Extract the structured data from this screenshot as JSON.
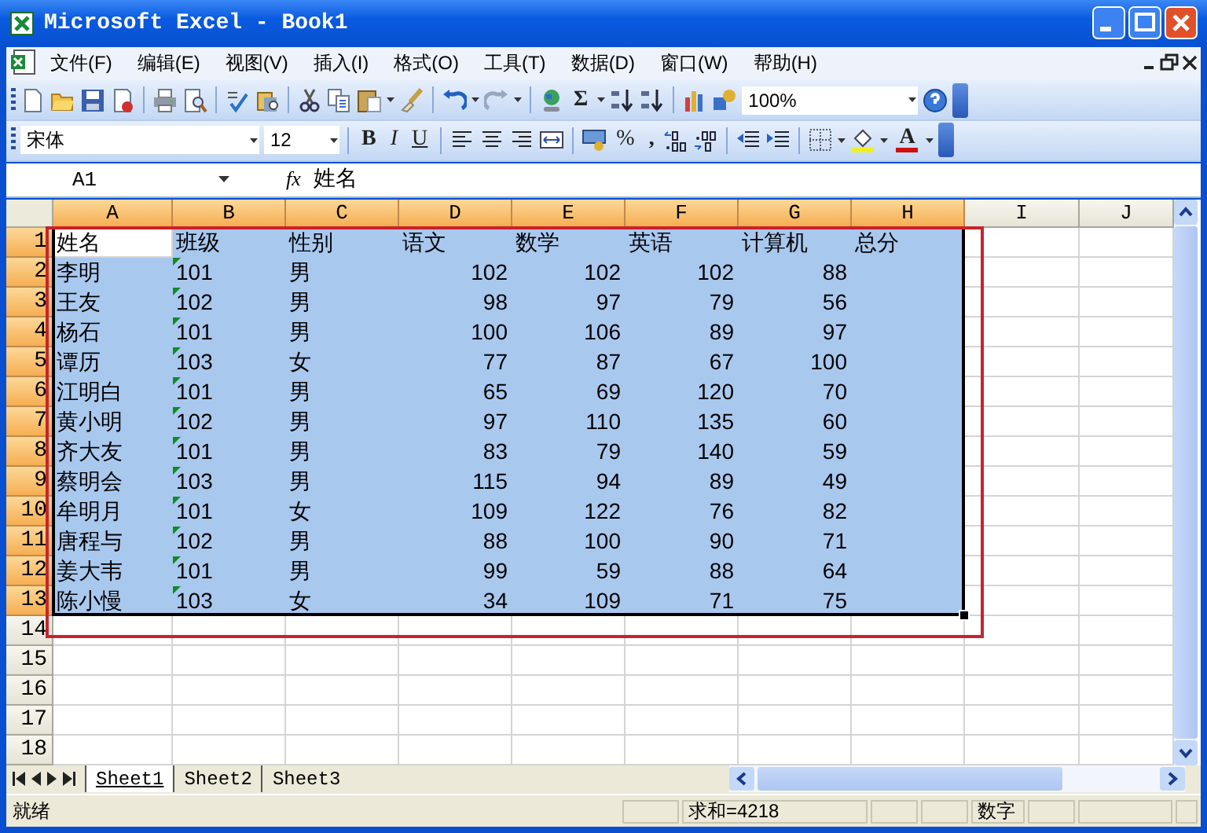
{
  "window": {
    "title": "Microsoft Excel - Book1"
  },
  "menu": [
    {
      "label": "文件(F)"
    },
    {
      "label": "编辑(E)"
    },
    {
      "label": "视图(V)"
    },
    {
      "label": "插入(I)"
    },
    {
      "label": "格式(O)"
    },
    {
      "label": "工具(T)"
    },
    {
      "label": "数据(D)"
    },
    {
      "label": "窗口(W)"
    },
    {
      "label": "帮助(H)"
    }
  ],
  "standard_toolbar": {
    "autosum": "Σ",
    "zoom": "100%"
  },
  "format_toolbar": {
    "font": "宋体",
    "size": "12",
    "bold": "B",
    "italic": "I",
    "underline": "U",
    "percent": "%",
    "comma": ",",
    "font_color": "A"
  },
  "formula_bar": {
    "name_box": "A1",
    "function_label": "fx",
    "formula": "姓名"
  },
  "columns": [
    {
      "label": "A",
      "selected": true
    },
    {
      "label": "B",
      "selected": true
    },
    {
      "label": "C",
      "selected": true
    },
    {
      "label": "D",
      "selected": true
    },
    {
      "label": "E",
      "selected": true
    },
    {
      "label": "F",
      "selected": true
    },
    {
      "label": "G",
      "selected": true
    },
    {
      "label": "H",
      "selected": true
    },
    {
      "label": "I",
      "selected": false
    },
    {
      "label": "J",
      "selected": false
    }
  ],
  "rows": [
    {
      "number": "1",
      "selected": true,
      "cells": [
        {
          "text": "姓名",
          "kind": "text",
          "active": true
        },
        {
          "text": "班级",
          "kind": "text",
          "active": false
        },
        {
          "text": "性别",
          "kind": "text",
          "active": false
        },
        {
          "text": "语文",
          "kind": "text",
          "active": false
        },
        {
          "text": "数学",
          "kind": "text",
          "active": false
        },
        {
          "text": "英语",
          "kind": "text",
          "active": false
        },
        {
          "text": "计算机",
          "kind": "text",
          "active": false
        },
        {
          "text": "总分",
          "kind": "text",
          "active": false
        }
      ]
    },
    {
      "number": "2",
      "selected": true,
      "cells": [
        {
          "text": "李明",
          "kind": "text",
          "active": false
        },
        {
          "text": "101",
          "kind": "flagged",
          "active": false
        },
        {
          "text": "男",
          "kind": "text",
          "active": false
        },
        {
          "text": "102",
          "kind": "number",
          "active": false
        },
        {
          "text": "102",
          "kind": "number",
          "active": false
        },
        {
          "text": "102",
          "kind": "number",
          "active": false
        },
        {
          "text": "88",
          "kind": "number",
          "active": false
        }
      ]
    },
    {
      "number": "3",
      "selected": true,
      "cells": [
        {
          "text": "王友",
          "kind": "text",
          "active": false
        },
        {
          "text": "102",
          "kind": "flagged",
          "active": false
        },
        {
          "text": "男",
          "kind": "text",
          "active": false
        },
        {
          "text": "98",
          "kind": "number",
          "active": false
        },
        {
          "text": "97",
          "kind": "number",
          "active": false
        },
        {
          "text": "79",
          "kind": "number",
          "active": false
        },
        {
          "text": "56",
          "kind": "number",
          "active": false
        }
      ]
    },
    {
      "number": "4",
      "selected": true,
      "cells": [
        {
          "text": "杨石",
          "kind": "text",
          "active": false
        },
        {
          "text": "101",
          "kind": "flagged",
          "active": false
        },
        {
          "text": "男",
          "kind": "text",
          "active": false
        },
        {
          "text": "100",
          "kind": "number",
          "active": false
        },
        {
          "text": "106",
          "kind": "number",
          "active": false
        },
        {
          "text": "89",
          "kind": "number",
          "active": false
        },
        {
          "text": "97",
          "kind": "number",
          "active": false
        }
      ]
    },
    {
      "number": "5",
      "selected": true,
      "cells": [
        {
          "text": "谭历",
          "kind": "text",
          "active": false
        },
        {
          "text": "103",
          "kind": "flagged",
          "active": false
        },
        {
          "text": "女",
          "kind": "text",
          "active": false
        },
        {
          "text": "77",
          "kind": "number",
          "active": false
        },
        {
          "text": "87",
          "kind": "number",
          "active": false
        },
        {
          "text": "67",
          "kind": "number",
          "active": false
        },
        {
          "text": "100",
          "kind": "number",
          "active": false
        }
      ]
    },
    {
      "number": "6",
      "selected": true,
      "cells": [
        {
          "text": "江明白",
          "kind": "text",
          "active": false
        },
        {
          "text": "101",
          "kind": "flagged",
          "active": false
        },
        {
          "text": "男",
          "kind": "text",
          "active": false
        },
        {
          "text": "65",
          "kind": "number",
          "active": false
        },
        {
          "text": "69",
          "kind": "number",
          "active": false
        },
        {
          "text": "120",
          "kind": "number",
          "active": false
        },
        {
          "text": "70",
          "kind": "number",
          "active": false
        }
      ]
    },
    {
      "number": "7",
      "selected": true,
      "cells": [
        {
          "text": "黄小明",
          "kind": "text",
          "active": false
        },
        {
          "text": "102",
          "kind": "flagged",
          "active": false
        },
        {
          "text": "男",
          "kind": "text",
          "active": false
        },
        {
          "text": "97",
          "kind": "number",
          "active": false
        },
        {
          "text": "110",
          "kind": "number",
          "active": false
        },
        {
          "text": "135",
          "kind": "number",
          "active": false
        },
        {
          "text": "60",
          "kind": "number",
          "active": false
        }
      ]
    },
    {
      "number": "8",
      "selected": true,
      "cells": [
        {
          "text": "齐大友",
          "kind": "text",
          "active": false
        },
        {
          "text": "101",
          "kind": "flagged",
          "active": false
        },
        {
          "text": "男",
          "kind": "text",
          "active": false
        },
        {
          "text": "83",
          "kind": "number",
          "active": false
        },
        {
          "text": "79",
          "kind": "number",
          "active": false
        },
        {
          "text": "140",
          "kind": "number",
          "active": false
        },
        {
          "text": "59",
          "kind": "number",
          "active": false
        }
      ]
    },
    {
      "number": "9",
      "selected": true,
      "cells": [
        {
          "text": "蔡明会",
          "kind": "text",
          "active": false
        },
        {
          "text": "103",
          "kind": "flagged",
          "active": false
        },
        {
          "text": "男",
          "kind": "text",
          "active": false
        },
        {
          "text": "115",
          "kind": "number",
          "active": false
        },
        {
          "text": "94",
          "kind": "number",
          "active": false
        },
        {
          "text": "89",
          "kind": "number",
          "active": false
        },
        {
          "text": "49",
          "kind": "number",
          "active": false
        }
      ]
    },
    {
      "number": "10",
      "selected": true,
      "cells": [
        {
          "text": "牟明月",
          "kind": "text",
          "active": false
        },
        {
          "text": "101",
          "kind": "flagged",
          "active": false
        },
        {
          "text": "女",
          "kind": "text",
          "active": false
        },
        {
          "text": "109",
          "kind": "number",
          "active": false
        },
        {
          "text": "122",
          "kind": "number",
          "active": false
        },
        {
          "text": "76",
          "kind": "number",
          "active": false
        },
        {
          "text": "82",
          "kind": "number",
          "active": false
        }
      ]
    },
    {
      "number": "11",
      "selected": true,
      "cells": [
        {
          "text": "唐程与",
          "kind": "text",
          "active": false
        },
        {
          "text": "102",
          "kind": "flagged",
          "active": false
        },
        {
          "text": "男",
          "kind": "text",
          "active": false
        },
        {
          "text": "88",
          "kind": "number",
          "active": false
        },
        {
          "text": "100",
          "kind": "number",
          "active": false
        },
        {
          "text": "90",
          "kind": "number",
          "active": false
        },
        {
          "text": "71",
          "kind": "number",
          "active": false
        }
      ]
    },
    {
      "number": "12",
      "selected": true,
      "cells": [
        {
          "text": "姜大韦",
          "kind": "text",
          "active": false
        },
        {
          "text": "101",
          "kind": "flagged",
          "active": false
        },
        {
          "text": "男",
          "kind": "text",
          "active": false
        },
        {
          "text": "99",
          "kind": "number",
          "active": false
        },
        {
          "text": "59",
          "kind": "number",
          "active": false
        },
        {
          "text": "88",
          "kind": "number",
          "active": false
        },
        {
          "text": "64",
          "kind": "number",
          "active": false
        }
      ]
    },
    {
      "number": "13",
      "selected": true,
      "cells": [
        {
          "text": "陈小慢",
          "kind": "text",
          "active": false
        },
        {
          "text": "103",
          "kind": "flagged",
          "active": false
        },
        {
          "text": "女",
          "kind": "text",
          "active": false
        },
        {
          "text": "34",
          "kind": "number",
          "active": false
        },
        {
          "text": "109",
          "kind": "number",
          "active": false
        },
        {
          "text": "71",
          "kind": "number",
          "active": false
        },
        {
          "text": "75",
          "kind": "number",
          "active": false
        }
      ]
    },
    {
      "number": "14",
      "selected": false
    },
    {
      "number": "15",
      "selected": false
    },
    {
      "number": "16",
      "selected": false
    },
    {
      "number": "17",
      "selected": false
    },
    {
      "number": "18",
      "selected": false
    }
  ],
  "sheet_tabs": [
    {
      "label": "Sheet1",
      "selected": true
    },
    {
      "label": "Sheet2",
      "selected": false
    },
    {
      "label": "Sheet3",
      "selected": false
    }
  ],
  "status_bar": {
    "mode": "就绪",
    "sum": "求和=4218",
    "num_lock": "数字"
  }
}
